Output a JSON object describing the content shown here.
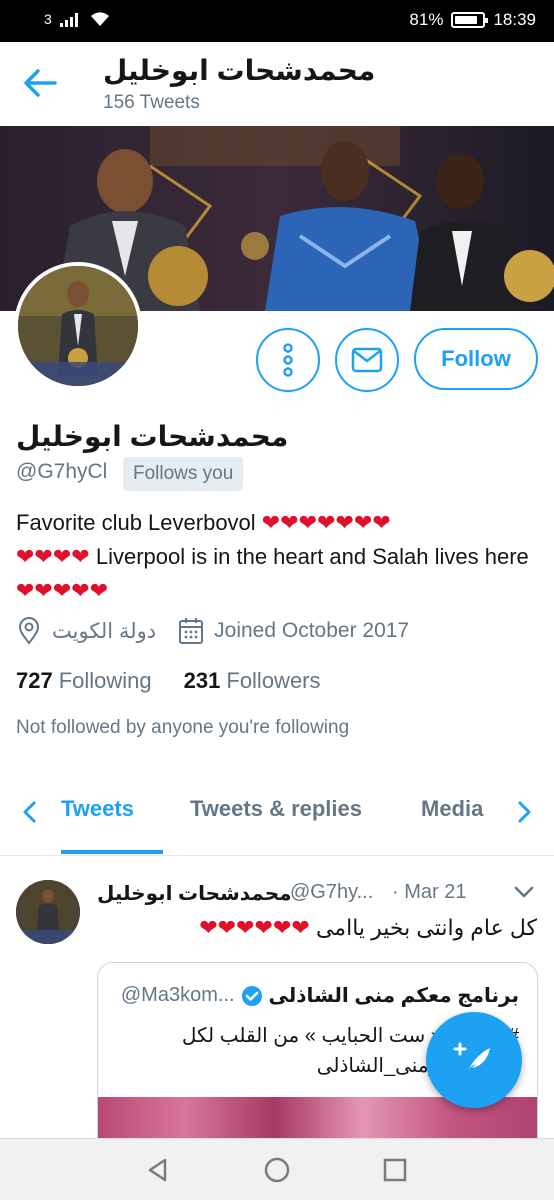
{
  "status_bar": {
    "sim": "3",
    "battery": "81%",
    "battery_level": 0.81,
    "time": "18:39"
  },
  "header": {
    "name": "محمدشحات ابوخليل",
    "tweet_count": "156 Tweets"
  },
  "profile": {
    "name": "محمدشحات ابوخليل",
    "handle": "@G7hyCl",
    "follows_you": "Follows you",
    "follow_label": "Follow",
    "bio": [
      {
        "text": "Favorite club Leverbovol ",
        "hearts": 7
      },
      {
        "text": "",
        "hearts": 4
      },
      {
        "text": " Liverpool is in the heart and Salah lives here",
        "hearts": 5
      }
    ],
    "location": "دولة الكويت",
    "joined": "Joined October 2017",
    "following_count": "727",
    "following_label": "Following",
    "followers_count": "231",
    "followers_label": "Followers",
    "not_followed": "Not followed by anyone you're following"
  },
  "tabs": [
    {
      "label": "Tweets",
      "active": true
    },
    {
      "label": "Tweets & replies",
      "active": false
    },
    {
      "label": "Media",
      "active": false
    }
  ],
  "tweet": {
    "name": "محمدشحات ابوخليل",
    "handle": "@G7hy...",
    "dot": "·",
    "date": "Mar 21",
    "text": "كل عام وانتى بخير ياامى",
    "hearts": 6,
    "quote": {
      "name": "برنامج معكم منى الشاذلى",
      "handle": "@Ma3kom...",
      "line1": "#مع مني « ست الحبايب » من القلب لكل",
      "line2": "أم #معكم_منى_الشاذلى"
    }
  },
  "colors": {
    "accent": "#1da1f2",
    "heart": "#e0102c",
    "secondary_text": "#657786"
  }
}
